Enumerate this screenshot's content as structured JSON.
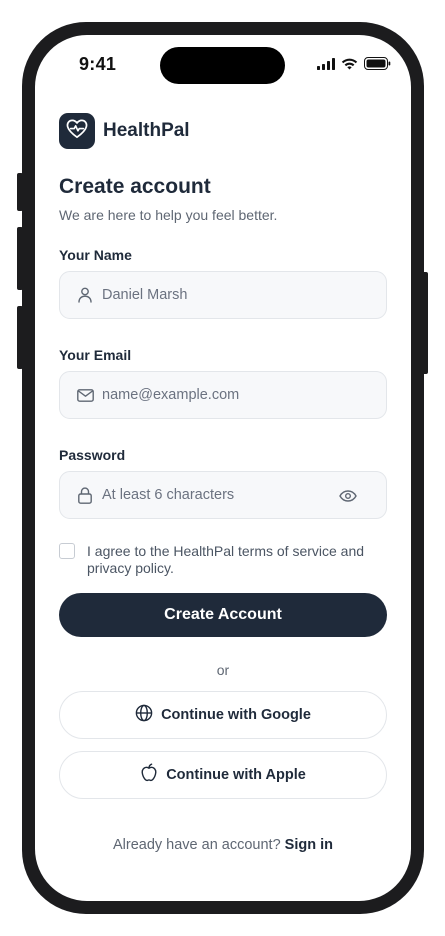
{
  "status_bar": {
    "time": "9:41",
    "icons": [
      "signal-icon",
      "wifi-icon",
      "battery-icon"
    ]
  },
  "brand": {
    "name": "HealthPal",
    "logo_icon": "heart-pulse-icon",
    "color": "#1f2a3a"
  },
  "header": {
    "title": "Create account",
    "subtitle": "We are here to help you feel better."
  },
  "form": {
    "name": {
      "label": "Your Name",
      "value": "Daniel Marsh",
      "placeholder": "Daniel Marsh",
      "icon": "user-icon"
    },
    "email": {
      "label": "Your Email",
      "value": "",
      "placeholder": "name@example.com",
      "icon": "mail-icon"
    },
    "password": {
      "label": "Password",
      "value": "",
      "placeholder": "At least 6 characters",
      "icon": "lock-icon",
      "toggle_icon": "eye-icon"
    },
    "agree_text": "I agree to the HealthPal terms of service and privacy policy.",
    "agree_checked": false
  },
  "actions": {
    "create_label": "Create Account",
    "or_label": "or",
    "google_label": "Continue with Google",
    "google_icon": "globe-icon",
    "apple_label": "Continue with Apple",
    "apple_icon": "apple-icon"
  },
  "footer": {
    "prompt": "Already have an account?",
    "signin_label": "Sign in"
  },
  "colors": {
    "primary": "#1f2a3a",
    "field_bg": "#f7f8fa",
    "border": "#e3e6ea",
    "muted_text": "#5f6773"
  }
}
